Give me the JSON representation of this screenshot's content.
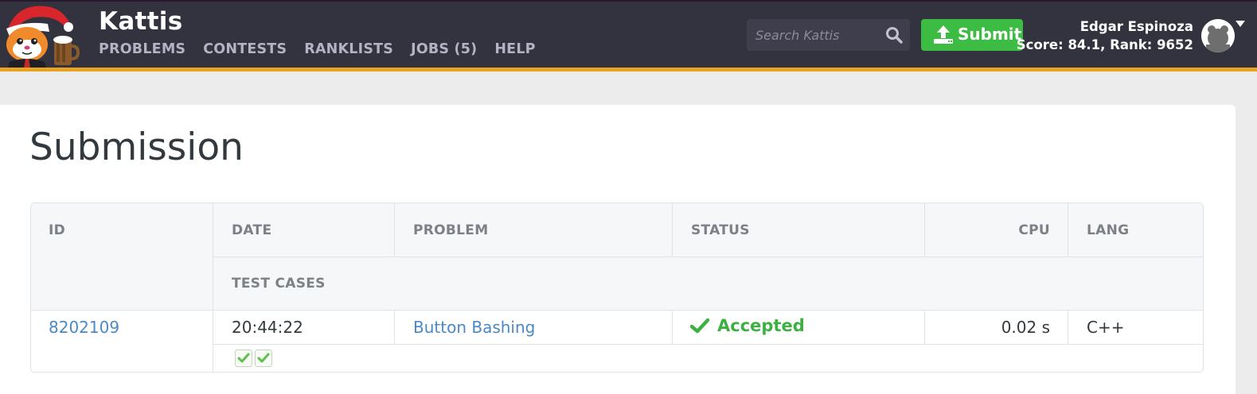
{
  "header": {
    "site_title": "Kattis",
    "nav": [
      "PROBLEMS",
      "CONTESTS",
      "RANKLISTS",
      "JOBS (5)",
      "HELP"
    ],
    "search_placeholder": "Search Kattis",
    "submit_label": "Submit",
    "user_name": "Edgar Espinoza",
    "user_score": "Score: 84.1, Rank: 9652",
    "icons": {
      "search": "search-icon",
      "submit": "upload-icon",
      "avatar": "user-avatar-icon",
      "menu": "caret-down-icon"
    },
    "colors": {
      "header_bg": "#33323f",
      "accent_bar": "#e8a321",
      "submit_bg": "#3dbc43"
    }
  },
  "main": {
    "page_title": "Submission",
    "table": {
      "headers": {
        "id": "ID",
        "date": "DATE",
        "problem": "PROBLEM",
        "status": "STATUS",
        "cpu": "CPU",
        "lang": "LANG",
        "test_cases": "TEST CASES"
      },
      "row": {
        "id": "8202109",
        "date": "20:44:22",
        "problem": "Button Bashing",
        "status": "Accepted",
        "cpu": "0.02 s",
        "lang": "C++",
        "test_cases": [
          "accepted",
          "accepted"
        ]
      }
    },
    "colors": {
      "link": "#4a8ac4",
      "accepted": "#3cb043"
    }
  }
}
